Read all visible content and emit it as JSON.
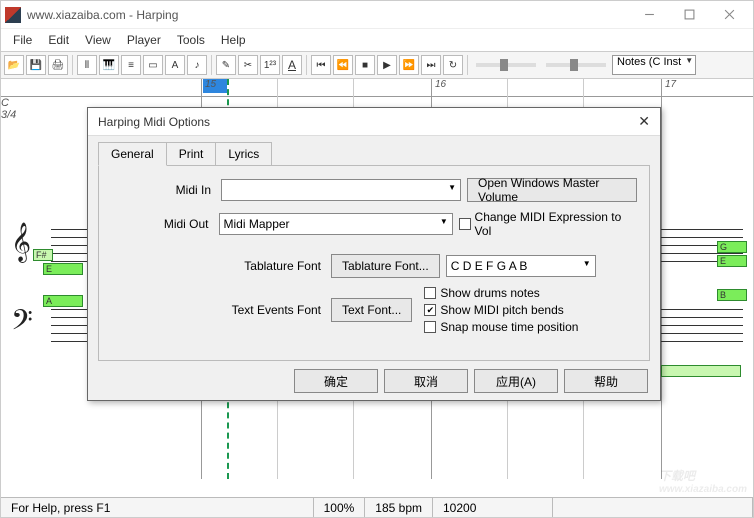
{
  "window": {
    "title": "www.xiazaiba.com - Harping"
  },
  "menu": {
    "file": "File",
    "edit": "Edit",
    "view": "View",
    "player": "Player",
    "tools": "Tools",
    "help": "Help"
  },
  "toolbar": {
    "notes_combo": "Notes (C Inst"
  },
  "ruler": {
    "t15": "15",
    "t16": "16",
    "t17": "17"
  },
  "key": {
    "clef": "C",
    "time": "3/4"
  },
  "notes": {
    "g": "G",
    "e": "E",
    "a": "A",
    "b": "B",
    "fsharp": "F#"
  },
  "dialog": {
    "title": "Harping Midi Options",
    "tabs": {
      "general": "General",
      "print": "Print",
      "lyrics": "Lyrics"
    },
    "midi_in_label": "Midi In",
    "midi_in_value": "",
    "midi_out_label": "Midi Out",
    "midi_out_value": "Midi Mapper",
    "open_volume": "Open Windows Master Volume",
    "change_expr": "Change MIDI Expression to Vol",
    "tab_font_label": "Tablature Font",
    "tab_font_btn": "Tablature Font...",
    "tab_font_sample": "C D E F G A B",
    "text_font_label": "Text Events Font",
    "text_font_btn": "Text Font...",
    "show_drums": "Show drums notes",
    "show_bends": "Show MIDI pitch bends",
    "snap_mouse": "Snap mouse time position",
    "ok": "确定",
    "cancel": "取消",
    "apply": "应用(A)",
    "help": "帮助"
  },
  "status": {
    "hint": "For Help, press F1",
    "zoom": "100%",
    "tempo": "185 bpm",
    "pos": "10200"
  },
  "watermark": {
    "text": "下载吧",
    "url": "www.xiazaiba.com"
  }
}
